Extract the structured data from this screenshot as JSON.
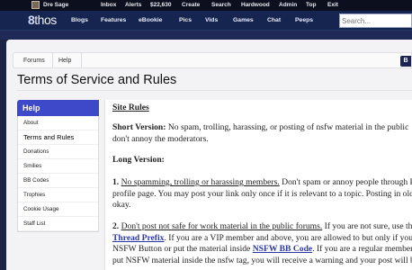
{
  "topbar": {
    "username": "Dre Sage",
    "links": [
      "Inbox",
      "Alerts",
      "$22,630",
      "Create",
      "Search",
      "Hardwood",
      "Admin",
      "Top",
      "Exit"
    ]
  },
  "nav": {
    "logo_prefix": "8",
    "logo_rest": "thos",
    "items": [
      "Blogs",
      "Features",
      "eBookie",
      "Pics",
      "Vids",
      "Games",
      "Chat",
      "Peeps"
    ],
    "search_placeholder": "Search..."
  },
  "breadcrumb": {
    "items": [
      "Forums",
      "Help"
    ],
    "button_label": "B"
  },
  "page_title": "Terms of Service and Rules",
  "sidebar": {
    "heading": "Help",
    "items": [
      "About",
      "Terms and Rules",
      "Donations",
      "Smilies",
      "BB Codes",
      "Trophies",
      "Cookie Usage",
      "Staff List"
    ]
  },
  "article": {
    "heading": "Site Rules",
    "short_label": "Short Version:",
    "short_line1": " No spam, trolling, harassing, or posting of nsfw material in the public",
    "short_line2": "don't annoy the moderators.",
    "long_label": "Long Version:",
    "rule1_num": "1.",
    "rule1_title": "No spamming, trolling or harassing members.",
    "rule1_line1": " Don't spam or annoy people through P",
    "rule1_line2": "profile page. You may post your link only once if it is relevant to a topic. Posting in old t",
    "rule1_line3": "okay.",
    "rule2_num": "2.",
    "rule2_title": "Don't post not safe for work material in the public forums.",
    "rule2_line1": " If you are not sure, use th",
    "rule2_link1": "Thread Prefix",
    "rule2_line2": ". If you are a VIP member and above, you are allowed to but only if you",
    "rule2_line3a": "NSFW Button or put the material inside ",
    "rule2_link2": "NSFW BB Code",
    "rule2_line3b": ". If you are a regular member",
    "rule2_line4": "put NSFW material inside the nsfw tag, you will receive a warning and your post will be"
  }
}
